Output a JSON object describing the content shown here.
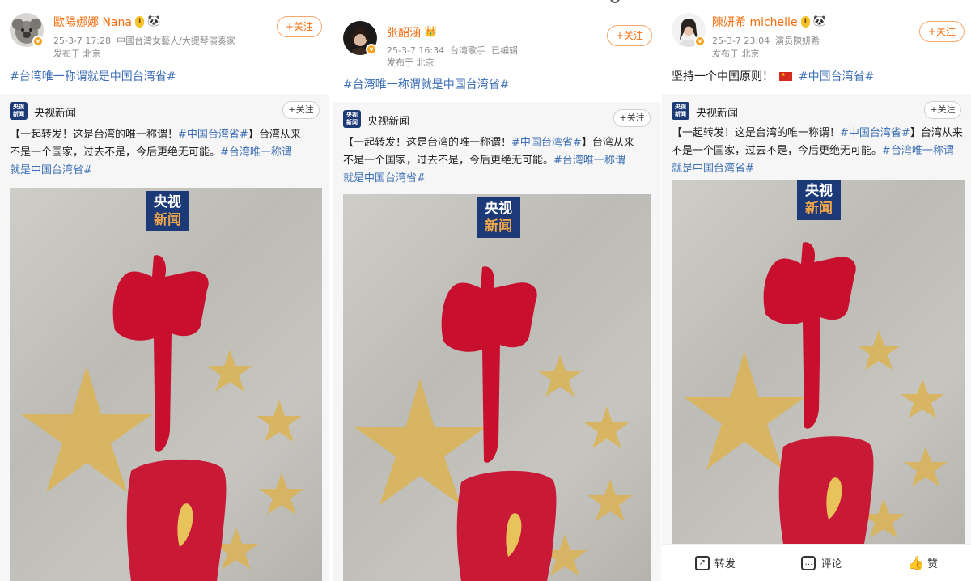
{
  "columns": [
    {
      "user": {
        "name": "歐陽娜娜 Nana",
        "level_badge": "I",
        "date": "25-3-7 17:28",
        "source": "中國台灣女藝人/大提琴演奏家",
        "location": "发布于 北京",
        "follow_label": "+关注",
        "avatar_icon": "koala-avatar-icon"
      },
      "post_text": "#台湾唯一称谓就是中国台湾省#",
      "repost": {
        "account": "央视新闻",
        "follow_label": "+关注",
        "logo_line1": "央视",
        "logo_line2": "新闻",
        "lines": [
          [
            "【一起转发！这是台湾的唯一称谓！",
            "#中国台湾省#",
            "】台湾从来"
          ],
          [
            "不是一个国家，过去不是，今后更绝无可能。",
            "#台湾唯一称谓",
            ""
          ],
          [
            "",
            "就是中国台湾省#",
            ""
          ]
        ]
      },
      "poster": {
        "logo_top": "央视",
        "logo_bottom": "新闻"
      }
    },
    {
      "user": {
        "name": "张韶涵",
        "date": "25-3-7 16:34",
        "source": "台湾歌手",
        "edited": "已编辑",
        "location": "发布于 北京",
        "follow_label": "+关注",
        "avatar_icon": "woman-portrait-avatar-icon"
      },
      "post_text": "#台湾唯一称谓就是中国台湾省#",
      "repost": {
        "account": "央视新闻",
        "follow_label": "+关注",
        "logo_line1": "央视",
        "logo_line2": "新闻",
        "lines": [
          [
            "【一起转发！这是台湾的唯一称谓！",
            "#中国台湾省#",
            "】台湾从来"
          ],
          [
            "不是一个国家，过去不是，今后更绝无可能。",
            "#台湾唯一称谓",
            ""
          ],
          [
            "",
            "就是中国台湾省#",
            ""
          ]
        ]
      },
      "poster": {
        "logo_top": "央视",
        "logo_bottom": "新闻"
      }
    },
    {
      "user": {
        "name": "陳妍希 michelle",
        "level_badge": "I",
        "date": "25-3-7 23:04",
        "source": "演员陳妍希",
        "location": "发布于 北京",
        "follow_label": "+关注",
        "avatar_icon": "woman-avatar-icon"
      },
      "post_text_plain": "坚持一个中国原则！",
      "post_flag": "china-flag-icon",
      "post_text": "#中国台湾省#",
      "repost": {
        "account": "央视新闻",
        "follow_label": "+关注",
        "logo_line1": "央视",
        "logo_line2": "新闻",
        "lines": [
          [
            "【一起转发！这是台湾的唯一称谓！",
            "#中国台湾省#",
            "】台湾从来"
          ],
          [
            "不是一个国家，过去不是，今后更绝无可能。",
            "#台湾唯一称谓",
            ""
          ],
          [
            "",
            "就是中国台湾省#",
            ""
          ]
        ]
      },
      "poster": {
        "logo_top": "央视",
        "logo_bottom": "新闻"
      },
      "actions": {
        "repost": "转发",
        "comment": "评论",
        "like": "赞"
      }
    }
  ],
  "colors": {
    "username": "#f56c0d",
    "hashtag": "#3d6fb4",
    "logo_blue": "#1c3a78",
    "calligraphy_red": "#c8102e",
    "star_gold": "#d9b45a"
  }
}
